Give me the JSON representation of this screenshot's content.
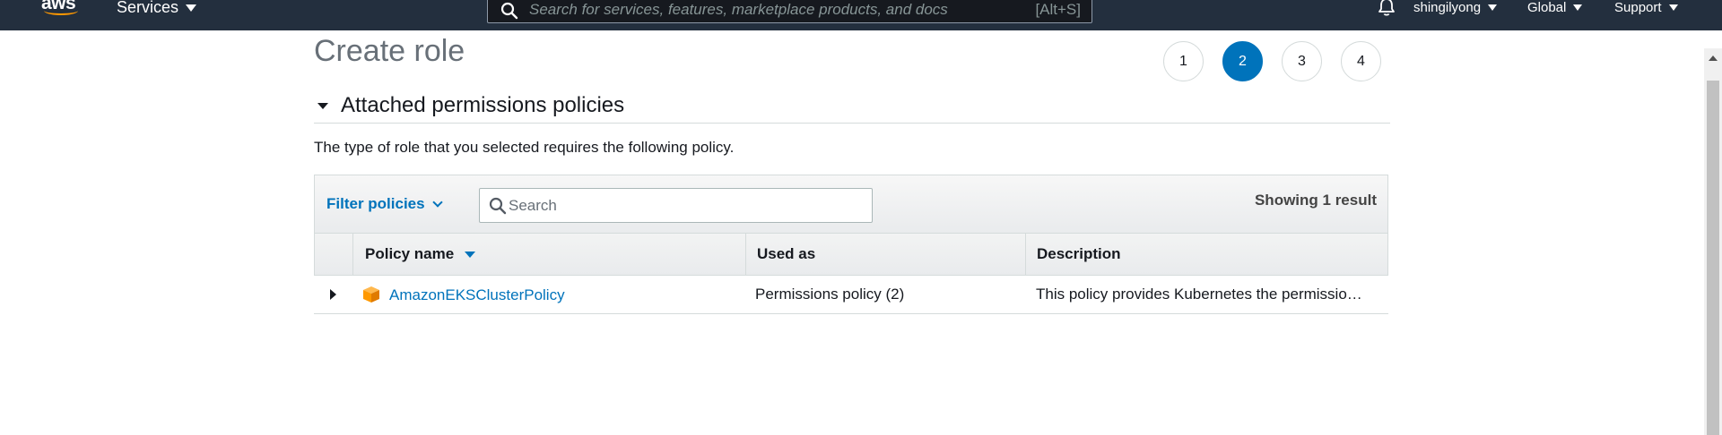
{
  "topnav": {
    "logo_text": "aws",
    "services_label": "Services",
    "search_placeholder": "Search for services, features, marketplace products, and docs",
    "search_shortcut": "[Alt+S]",
    "user_label": "shingilyong",
    "region_label": "Global",
    "support_label": "Support"
  },
  "page": {
    "title": "Create role",
    "steps": [
      "1",
      "2",
      "3",
      "4"
    ],
    "active_step": "2"
  },
  "section": {
    "title": "Attached permissions policies",
    "description": "The type of role that you selected requires the following policy."
  },
  "table": {
    "filter_label": "Filter policies",
    "search_placeholder": "Search",
    "result_count": "Showing 1 result",
    "columns": {
      "name": "Policy name",
      "used_as": "Used as",
      "description": "Description"
    },
    "rows": [
      {
        "name": "AmazonEKSClusterPolicy",
        "used_as": "Permissions policy (2)",
        "description": "This policy provides Kubernetes the permissio…"
      }
    ]
  },
  "colors": {
    "nav_bg": "#232f3e",
    "accent_blue": "#0073bb",
    "brand_orange": "#ff9900",
    "policy_icon": "#ff9900"
  },
  "icons": {
    "search": "search-icon",
    "bell": "bell-icon",
    "policy": "cube-icon"
  }
}
